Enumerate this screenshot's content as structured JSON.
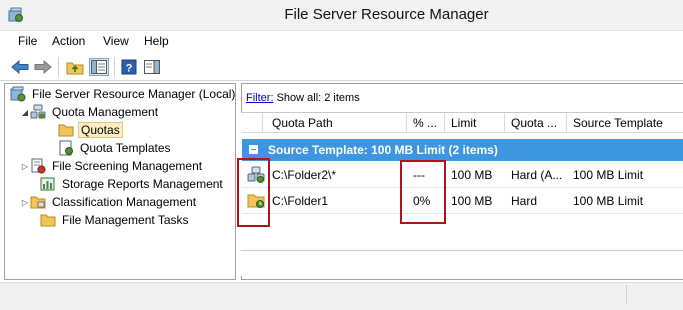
{
  "window": {
    "title": "File Server Resource Manager",
    "icon": "fsrm-app-icon"
  },
  "menu": [
    "File",
    "Action",
    "View",
    "Help"
  ],
  "toolbar": {
    "buttons": [
      "back-arrow-icon",
      "forward-arrow-icon",
      "up-folder-icon",
      "show-hide-tree-icon",
      "help-icon",
      "action-pane-icon"
    ]
  },
  "tree": {
    "items": [
      {
        "label": "File Server Resource Manager (Local)",
        "icon": "fsrm-server-icon",
        "expander": ""
      },
      {
        "label": "Quota Management",
        "icon": "quota-management-icon",
        "expander": "◢"
      },
      {
        "label": "Quotas",
        "icon": "folder-icon",
        "expander": "",
        "selected": true
      },
      {
        "label": "Quota Templates",
        "icon": "quota-template-icon",
        "expander": ""
      },
      {
        "label": "File Screening Management",
        "icon": "file-screening-icon",
        "expander": "▷"
      },
      {
        "label": "Storage Reports Management",
        "icon": "storage-reports-icon",
        "expander": ""
      },
      {
        "label": "Classification Management",
        "icon": "classification-icon",
        "expander": "▷"
      },
      {
        "label": "File Management Tasks",
        "icon": "folder-icon",
        "expander": ""
      }
    ]
  },
  "filter": {
    "link": "Filter:",
    "text": "Show all: 2 items"
  },
  "grid": {
    "columns": [
      "Quota Path",
      "% ...",
      "Limit",
      "Quota ...",
      "Source Template"
    ],
    "group": "Source Template: 100 MB Limit (2 items)",
    "rows": [
      {
        "path": "C:\\Folder2\\*",
        "percent": "---",
        "limit": "100 MB",
        "quota_type": "Hard (A...",
        "template": "100 MB Limit",
        "icon": "auto-apply-quota-icon"
      },
      {
        "path": "C:\\Folder1",
        "percent": "0%",
        "limit": "100 MB",
        "quota_type": "Hard",
        "template": "100 MB Limit",
        "icon": "quota-folder-icon"
      }
    ]
  },
  "colors": {
    "group_bg": "#3d97e0",
    "highlight_box": "#b2141a",
    "selection_bg": "#fbeec2"
  }
}
